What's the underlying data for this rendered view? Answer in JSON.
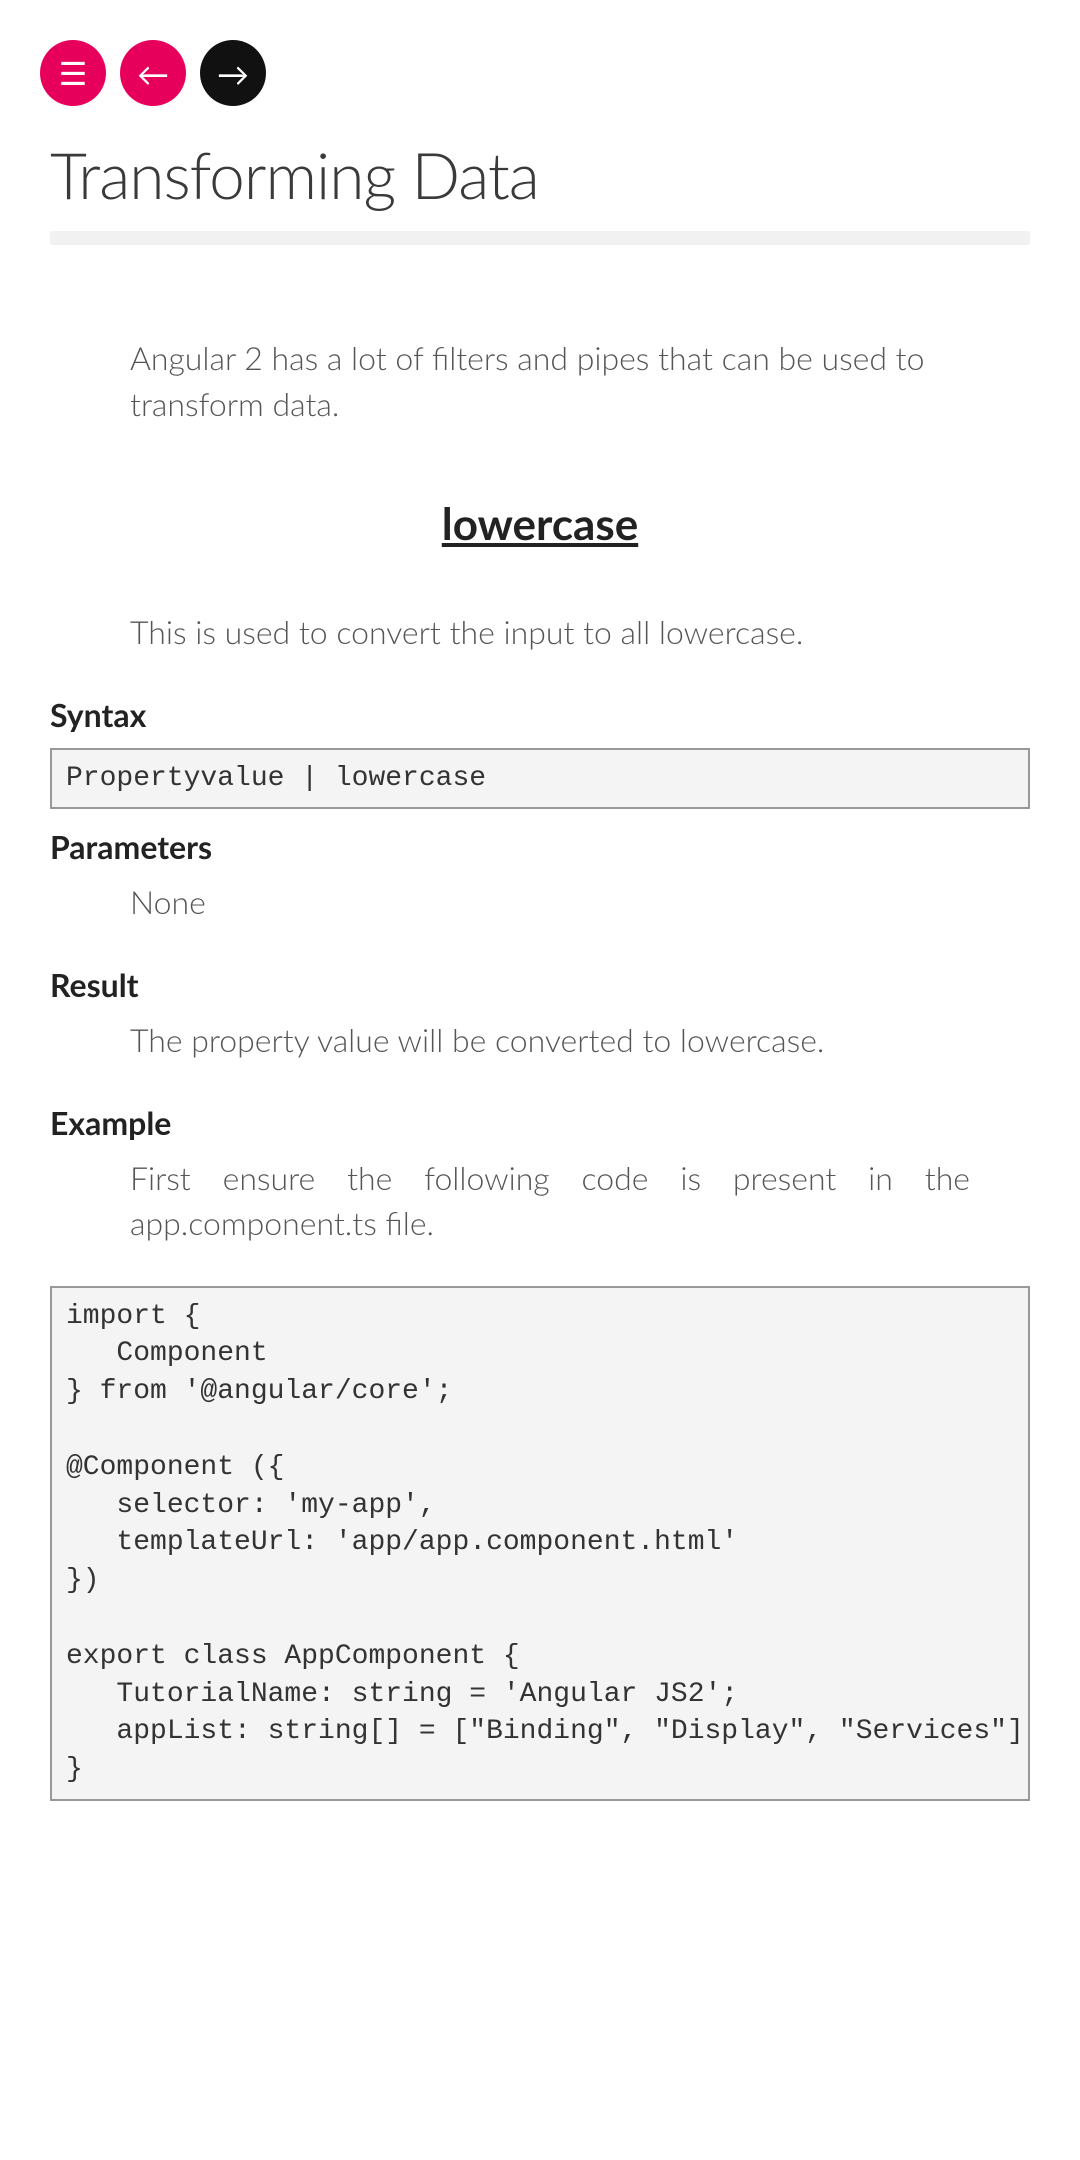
{
  "nav": {
    "menu_glyph": "☰",
    "prev_glyph": "←",
    "next_glyph": "→"
  },
  "page_title": "Transforming Data",
  "intro": "Angular 2 has a lot of filters and pipes that can be used to transform data.",
  "section": {
    "heading": "lowercase",
    "desc": "This is used to convert the input to all lowercase.",
    "syntax_label": "Syntax",
    "syntax_code": "Propertyvalue | lowercase ",
    "params_label": "Parameters",
    "params_text": "None",
    "result_label": "Result",
    "result_text": "The property value will be converted to lowercase.",
    "example_label": "Example",
    "example_text": "First ensure the following code is present in the app.component.ts file.",
    "example_code": "import {\n   Component\n} from '@angular/core';\n\n@Component ({\n   selector: 'my-app',\n   templateUrl: 'app/app.component.html'\n})\n\nexport class AppComponent {\n   TutorialName: string = 'Angular JS2';\n   appList: string[] = [\"Binding\", \"Display\", \"Services\"];\n}"
  }
}
